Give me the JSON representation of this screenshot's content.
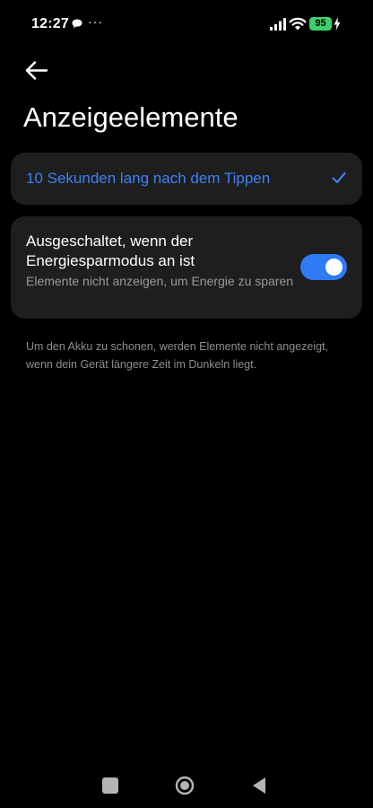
{
  "status_bar": {
    "time": "12:27",
    "notification_icon": "chat-bubble-icon",
    "more_indicator": "···",
    "signal_icon": "signal-bars-icon",
    "wifi_icon": "wifi-icon",
    "battery_level": "95",
    "battery_color": "#3cd06b",
    "charging_icon": "lightning-bolt-icon"
  },
  "header": {
    "back_icon": "arrow-left-icon",
    "title": "Anzeigeelemente"
  },
  "option": {
    "label": "10 Sekunden lang nach dem Tippen",
    "selected": true,
    "check_icon": "checkmark-icon",
    "accent_color": "#3b82f6"
  },
  "power_saving": {
    "title": "Ausgeschaltet, wenn der Energiesparmodus an ist",
    "subtitle": "Elemente nicht anzeigen, um Energie zu sparen",
    "enabled": true,
    "toggle_color": "#2f7bf5"
  },
  "footnote": "Um den Akku zu schonen, werden Elemente nicht angezeigt, wenn dein Gerät längere Zeit im Dunkeln liegt.",
  "nav_bar": {
    "recents_icon": "square-icon",
    "home_icon": "circle-home-icon",
    "back_icon": "triangle-back-icon"
  }
}
